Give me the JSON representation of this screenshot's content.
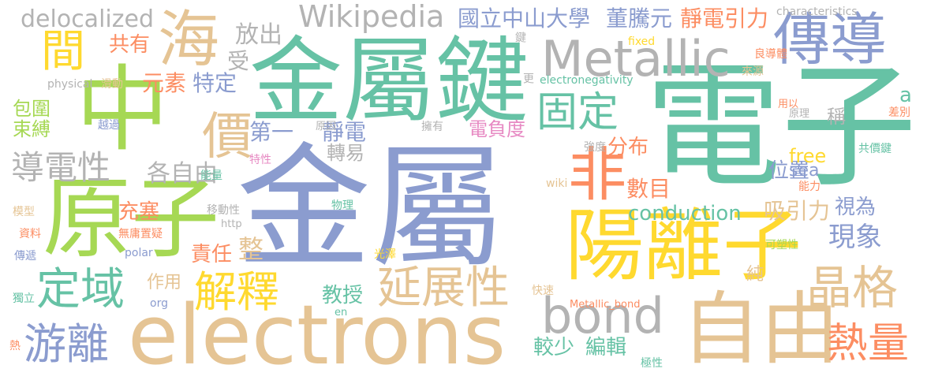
{
  "palette": {
    "blue": "#8b9ccf",
    "green": "#66c2a5",
    "tan": "#e5c494",
    "lime": "#a6d854",
    "yellow": "#ffd92f",
    "orange": "#fc8d62",
    "pink": "#e78ac3",
    "gray": "#b3b3b3"
  },
  "words": [
    "金屬",
    "電子",
    "金屬鍵",
    "electrons",
    "中",
    "原子",
    "陽離子",
    "自由",
    "Metallic",
    "海",
    "傳導",
    "bond",
    "非",
    "定域",
    "晶格",
    "延展性",
    "解釋",
    "固定",
    "游離",
    "熱量",
    "導電性",
    "Wikipedia",
    "國立中山大學",
    "董騰元",
    "靜電引力",
    "價",
    "間",
    "delocalized",
    "放出",
    "受",
    "共有",
    "元素",
    "特定",
    "第一",
    "靜電",
    "各自由",
    "數目",
    "分布",
    "電負度",
    "較少",
    "編輯",
    "教授",
    "conduction",
    "吸引力",
    "視為",
    "現象",
    "位置",
    "充塞",
    "責任",
    "整",
    "作用",
    "包圍",
    "束縛",
    "free",
    "sea",
    "稱",
    "a",
    "轉易",
    "characteristics",
    "fixed",
    "鍵",
    "良導體",
    "來源",
    "更",
    "electronegativity",
    "physical",
    "滑動",
    "越過",
    "原因",
    "擁有",
    "強度",
    "特性",
    "能量",
    "wiki",
    "能力",
    "共價鍵",
    "差別",
    "原理",
    "用以",
    "模型",
    "移動性",
    "物理",
    "http",
    "資料",
    "無庸置疑",
    "可塑性",
    "polar",
    "光澤",
    "傳遞",
    "純",
    "快速",
    "org",
    "en",
    "Metallic_bond",
    "極性",
    "獨立",
    "熱"
  ]
}
